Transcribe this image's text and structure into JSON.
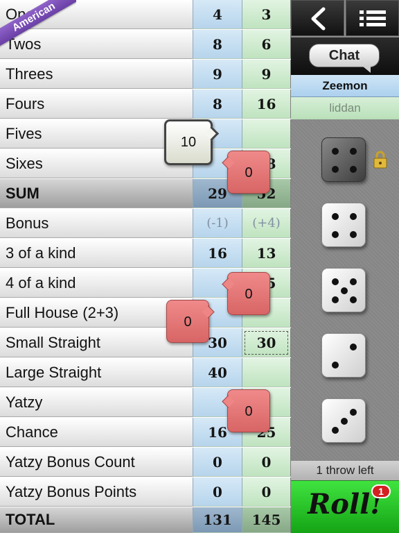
{
  "badge": "American",
  "rows": [
    {
      "label": "Ones",
      "p1": "4",
      "p2": "3"
    },
    {
      "label": "Twos",
      "p1": "8",
      "p2": "6"
    },
    {
      "label": "Threes",
      "p1": "9",
      "p2": "9"
    },
    {
      "label": "Fours",
      "p1": "8",
      "p2": "16"
    },
    {
      "label": "Fives",
      "p1": "",
      "p2": ""
    },
    {
      "label": "Sixes",
      "p1": "",
      "p2": "18"
    },
    {
      "label": "SUM",
      "p1": "29",
      "p2": "52"
    },
    {
      "label": "Bonus",
      "p1": "(-1)",
      "p2": "(+4)"
    },
    {
      "label": "3 of a kind",
      "p1": "16",
      "p2": "13"
    },
    {
      "label": "4 of a kind",
      "p1": "",
      "p2": "25"
    },
    {
      "label": "Full House (2+3)",
      "p1": "",
      "p2": ""
    },
    {
      "label": "Small Straight",
      "p1": "30",
      "p2": "30"
    },
    {
      "label": "Large Straight",
      "p1": "40",
      "p2": ""
    },
    {
      "label": "Yatzy",
      "p1": "",
      "p2": ""
    },
    {
      "label": "Chance",
      "p1": "16",
      "p2": "25"
    },
    {
      "label": "Yatzy Bonus Count",
      "p1": "0",
      "p2": "0"
    },
    {
      "label": "Yatzy Bonus Points",
      "p1": "0",
      "p2": "0"
    },
    {
      "label": "TOTAL",
      "p1": "131",
      "p2": "145"
    }
  ],
  "suggestions": {
    "fives": "10",
    "sixes": "0",
    "four_kind": "0",
    "full_house": "0",
    "yatzy": "0"
  },
  "panel": {
    "chat_label": "Chat",
    "player1": "Zeemon",
    "player2": "liddan",
    "throws_left": "1 throw left",
    "roll_label": "Roll!",
    "roll_badge": "1"
  },
  "dice": [
    {
      "value": 4,
      "held": true
    },
    {
      "value": 4,
      "held": false
    },
    {
      "value": 5,
      "held": false
    },
    {
      "value": 2,
      "held": false
    },
    {
      "value": 3,
      "held": false
    }
  ],
  "icons": {
    "back": "back-arrow-icon",
    "menu": "list-menu-icon",
    "lock": "padlock-icon"
  },
  "colors": {
    "player1_column": "#c4def2",
    "player2_column": "#cdeccd",
    "roll_button": "#2fcf2f",
    "suggestion_red": "#e57373",
    "badge_purple": "#7b4fb8"
  }
}
